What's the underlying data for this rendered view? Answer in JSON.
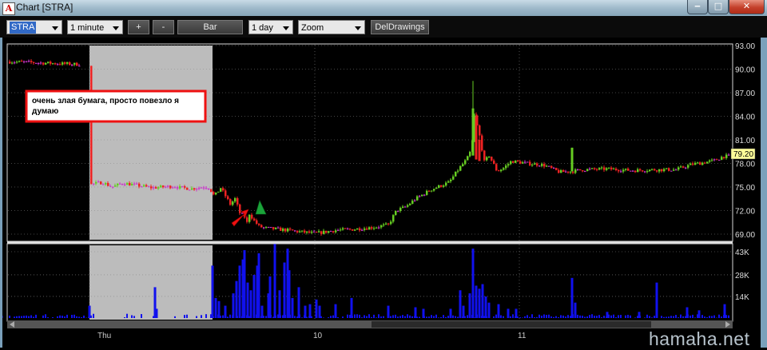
{
  "window": {
    "icon_glyph": "A",
    "title": "Chart [STRA]",
    "controls": {
      "minimize": "‒",
      "maximize": "□",
      "close": "✕"
    }
  },
  "toolbar": {
    "symbol": "STRA",
    "interval": "1 minute",
    "plus_label": "+",
    "minus_label": "-",
    "style_label": "Bar",
    "period": "1 day",
    "mode": "Zoom",
    "del_drawings_label": "DelDrawings"
  },
  "annotation": {
    "line1": "очень злая бумага, просто повезло я",
    "line2": "думаю"
  },
  "chart_data": {
    "type": "candlestick",
    "price_axis": {
      "min": 67.5,
      "max": 93.0,
      "ticks": [
        "93.00",
        "90.00",
        "87.00",
        "84.00",
        "81.00",
        "78.00",
        "75.00",
        "72.00",
        "69.00"
      ]
    },
    "last_price": "79.20",
    "volume_axis": {
      "max": 48000,
      "ticks": [
        "43K",
        "28K",
        "14K"
      ]
    },
    "time_labels": [
      "Thu",
      "10",
      "11"
    ],
    "colors": {
      "up": "#66cc22",
      "down": "#ee2222",
      "flat": "#cc33cc",
      "volume": "#1111ee",
      "grid": "#888888",
      "shade": "#bcbcbc",
      "last_price_bg": "#ffff99"
    },
    "price_path": [
      [
        0,
        91
      ],
      [
        100,
        90.6
      ],
      [
        110,
        91.2
      ],
      [
        112,
        75.3
      ],
      [
        128,
        75.6
      ],
      [
        140,
        75.0
      ],
      [
        154,
        75.5
      ],
      [
        190,
        74.9
      ],
      [
        218,
        75.1
      ],
      [
        226,
        74.9
      ],
      [
        240,
        74.8
      ],
      [
        254,
        75.0
      ],
      [
        262,
        74.9
      ],
      [
        268,
        73.8
      ],
      [
        276,
        74.9
      ],
      [
        288,
        72.8
      ],
      [
        294,
        73.5
      ],
      [
        300,
        71.7
      ],
      [
        306,
        71.2
      ],
      [
        310,
        70.2
      ],
      [
        312,
        71.6
      ],
      [
        318,
        70.7
      ],
      [
        324,
        70.0
      ],
      [
        330,
        69.8
      ],
      [
        360,
        69.5
      ],
      [
        375,
        69.3
      ],
      [
        395,
        69.1
      ],
      [
        420,
        69.5
      ],
      [
        440,
        69.6
      ],
      [
        470,
        69.9
      ],
      [
        486,
        70.2
      ],
      [
        496,
        72.0
      ],
      [
        508,
        72.5
      ],
      [
        520,
        73.5
      ],
      [
        540,
        74.7
      ],
      [
        562,
        75.6
      ],
      [
        574,
        77.3
      ],
      [
        584,
        78.5
      ],
      [
        590,
        79.8
      ],
      [
        594,
        84.0
      ],
      [
        600,
        81.5
      ],
      [
        606,
        78.2
      ],
      [
        612,
        79.0
      ],
      [
        622,
        77.0
      ],
      [
        630,
        77.4
      ],
      [
        640,
        78.3
      ],
      [
        660,
        78.0
      ],
      [
        680,
        77.8
      ],
      [
        700,
        76.9
      ],
      [
        716,
        77.0
      ],
      [
        730,
        77.2
      ],
      [
        760,
        77.3
      ],
      [
        790,
        77.1
      ],
      [
        820,
        77.2
      ],
      [
        846,
        77.2
      ],
      [
        866,
        77.9
      ],
      [
        880,
        78.1
      ],
      [
        895,
        78.4
      ],
      [
        905,
        78.9
      ]
    ],
    "volume_bars": [
      [
        2,
        1.5
      ],
      [
        112,
        8
      ],
      [
        194,
        20
      ],
      [
        196,
        6
      ],
      [
        266,
        34
      ],
      [
        270,
        13
      ],
      [
        274,
        11
      ],
      [
        282,
        8
      ],
      [
        292,
        16
      ],
      [
        296,
        24
      ],
      [
        300,
        34
      ],
      [
        304,
        38
      ],
      [
        306,
        44
      ],
      [
        310,
        23
      ],
      [
        314,
        18
      ],
      [
        318,
        28
      ],
      [
        322,
        34
      ],
      [
        324,
        42
      ],
      [
        328,
        8
      ],
      [
        336,
        16
      ],
      [
        338,
        27
      ],
      [
        344,
        48
      ],
      [
        350,
        18
      ],
      [
        356,
        36
      ],
      [
        360,
        45
      ],
      [
        362,
        31
      ],
      [
        366,
        13
      ],
      [
        374,
        20
      ],
      [
        382,
        8
      ],
      [
        388,
        9
      ],
      [
        396,
        12
      ],
      [
        400,
        8
      ],
      [
        420,
        9
      ],
      [
        440,
        13
      ],
      [
        486,
        8
      ],
      [
        520,
        7
      ],
      [
        530,
        6
      ],
      [
        564,
        6
      ],
      [
        576,
        18
      ],
      [
        580,
        8
      ],
      [
        588,
        16
      ],
      [
        592,
        45
      ],
      [
        596,
        21
      ],
      [
        600,
        19
      ],
      [
        604,
        22
      ],
      [
        608,
        14
      ],
      [
        612,
        10
      ],
      [
        624,
        9
      ],
      [
        636,
        6
      ],
      [
        646,
        6
      ],
      [
        716,
        26
      ],
      [
        720,
        10
      ],
      [
        760,
        4
      ],
      [
        800,
        4
      ],
      [
        822,
        23
      ],
      [
        860,
        7
      ],
      [
        875,
        5
      ],
      [
        907,
        9
      ]
    ]
  }
}
